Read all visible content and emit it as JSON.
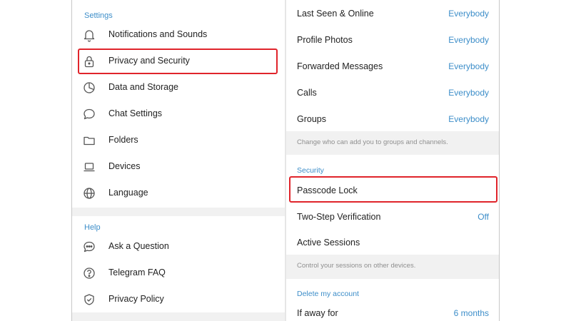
{
  "settings_panel": {
    "section_settings": "Settings",
    "items": [
      {
        "label": "Notifications and Sounds",
        "icon": "bell-icon"
      },
      {
        "label": "Privacy and Security",
        "icon": "lock-icon"
      },
      {
        "label": "Data and Storage",
        "icon": "pie-chart-icon"
      },
      {
        "label": "Chat Settings",
        "icon": "chat-bubble-icon"
      },
      {
        "label": "Folders",
        "icon": "folder-icon"
      },
      {
        "label": "Devices",
        "icon": "laptop-icon"
      },
      {
        "label": "Language",
        "icon": "globe-icon"
      }
    ],
    "section_help": "Help",
    "help_items": [
      {
        "label": "Ask a Question",
        "icon": "chat-dots-icon"
      },
      {
        "label": "Telegram FAQ",
        "icon": "question-circle-icon"
      },
      {
        "label": "Privacy Policy",
        "icon": "shield-check-icon"
      }
    ]
  },
  "privacy_panel": {
    "rows": [
      {
        "label": "Last Seen & Online",
        "value": "Everybody"
      },
      {
        "label": "Profile Photos",
        "value": "Everybody"
      },
      {
        "label": "Forwarded Messages",
        "value": "Everybody"
      },
      {
        "label": "Calls",
        "value": "Everybody"
      },
      {
        "label": "Groups",
        "value": "Everybody"
      }
    ],
    "groups_hint": "Change who can add you to groups and channels.",
    "section_security": "Security",
    "security_rows": [
      {
        "label": "Passcode Lock",
        "value": ""
      },
      {
        "label": "Two-Step Verification",
        "value": "Off"
      },
      {
        "label": "Active Sessions",
        "value": ""
      }
    ],
    "sessions_hint": "Control your sessions on other devices.",
    "section_delete": "Delete my account",
    "delete_row": {
      "label": "If away for",
      "value": "6 months"
    }
  },
  "colors": {
    "accent": "#3d8ec9",
    "highlight": "#e0242b",
    "hint_bg": "#f1f1f1"
  }
}
